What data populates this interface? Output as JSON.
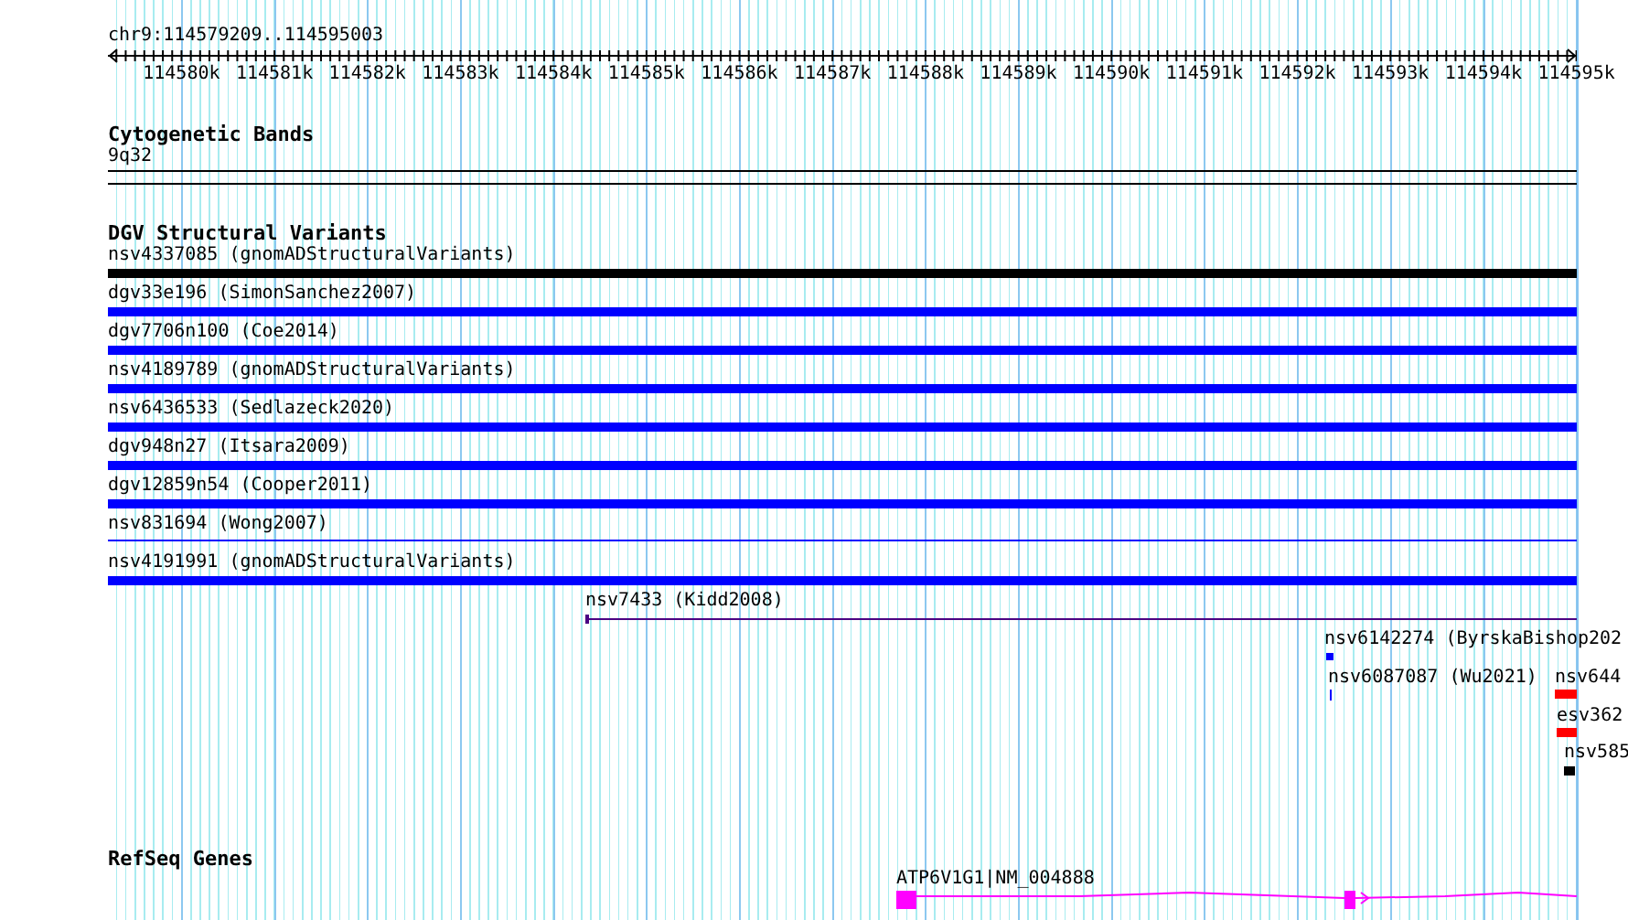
{
  "location": "chr9:114579209..114595003",
  "ruler": {
    "ticks": [
      "114580k",
      "114581k",
      "114582k",
      "114583k",
      "114584k",
      "114585k",
      "114586k",
      "114587k",
      "114588k",
      "114589k",
      "114590k",
      "114591k",
      "114592k",
      "114593k",
      "114594k",
      "114595k"
    ]
  },
  "cytobands": {
    "title": "Cytogenetic Bands",
    "bands": [
      "9q32"
    ]
  },
  "variants": {
    "title": "DGV Structural Variants",
    "features": [
      {
        "label": "nsv4337085 (gnomADStructuralVariants)",
        "color": "#000000"
      },
      {
        "label": "dgv33e196 (SimonSanchez2007)",
        "color": "#0000ff"
      },
      {
        "label": "dgv7706n100 (Coe2014)",
        "color": "#0000ff"
      },
      {
        "label": "nsv4189789 (gnomADStructuralVariants)",
        "color": "#0000ff"
      },
      {
        "label": "nsv6436533 (Sedlazeck2020)",
        "color": "#0000ff"
      },
      {
        "label": "dgv948n27 (Itsara2009)",
        "color": "#0000ff"
      },
      {
        "label": "dgv12859n54 (Cooper2011)",
        "color": "#0000ff"
      },
      {
        "label": "nsv831694 (Wong2007)",
        "color": "#0000ff"
      },
      {
        "label": "nsv4191991 (gnomADStructuralVariants)",
        "color": "#0000ff"
      },
      {
        "label": "nsv7433 (Kidd2008)",
        "color": "#4b0082"
      },
      {
        "label": "nsv6142274 (ByrskaBishop202",
        "color": "#0000ff"
      },
      {
        "label": "nsv6087087 (Wu2021)",
        "color": "#0000ff"
      },
      {
        "label": "nsv644",
        "color": "#ff0000"
      },
      {
        "label": "esv362",
        "color": "#ff0000"
      },
      {
        "label": "nsv585",
        "color": "#000000"
      }
    ]
  },
  "genes": {
    "title": "RefSeq Genes",
    "items": [
      {
        "label": "ATP6V1G1|NM_004888",
        "color": "#ff00ff"
      }
    ]
  }
}
